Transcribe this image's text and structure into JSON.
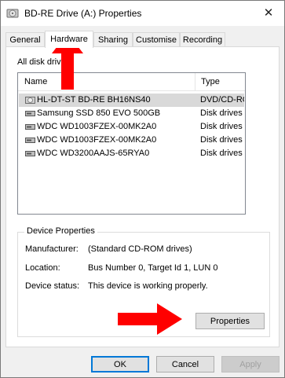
{
  "window": {
    "title": "BD-RE Drive (A:) Properties",
    "close_glyph": "✕"
  },
  "tabs": [
    {
      "label": "General",
      "active": false
    },
    {
      "label": "Hardware",
      "active": true
    },
    {
      "label": "Sharing",
      "active": false
    },
    {
      "label": "Customise",
      "active": false
    },
    {
      "label": "Recording",
      "active": false
    }
  ],
  "hardware": {
    "all_disk_drives_label": "All disk drives:",
    "columns": {
      "name": "Name",
      "type": "Type"
    },
    "devices": [
      {
        "name": "HL-DT-ST BD-RE  BH16NS40",
        "type": "DVD/CD-ROM drives",
        "icon": "optical-drive-icon",
        "selected": true
      },
      {
        "name": "Samsung SSD 850 EVO 500GB",
        "type": "Disk drives",
        "icon": "disk-drive-icon",
        "selected": false
      },
      {
        "name": "WDC WD1003FZEX-00MK2A0",
        "type": "Disk drives",
        "icon": "disk-drive-icon",
        "selected": false
      },
      {
        "name": "WDC WD1003FZEX-00MK2A0",
        "type": "Disk drives",
        "icon": "disk-drive-icon",
        "selected": false
      },
      {
        "name": "WDC WD3200AAJS-65RYA0",
        "type": "Disk drives",
        "icon": "disk-drive-icon",
        "selected": false
      }
    ],
    "device_properties": {
      "legend": "Device Properties",
      "manufacturer_label": "Manufacturer:",
      "manufacturer_value": "(Standard CD-ROM drives)",
      "location_label": "Location:",
      "location_value": "Bus Number 0, Target Id 1, LUN 0",
      "status_label": "Device status:",
      "status_value": "This device is working properly.",
      "properties_button": "Properties"
    }
  },
  "footer": {
    "ok": "OK",
    "cancel": "Cancel",
    "apply": "Apply"
  },
  "colors": {
    "annotation_arrow": "#ff0000",
    "selection": "#d9d9d9",
    "default_button_border": "#0078d7"
  }
}
